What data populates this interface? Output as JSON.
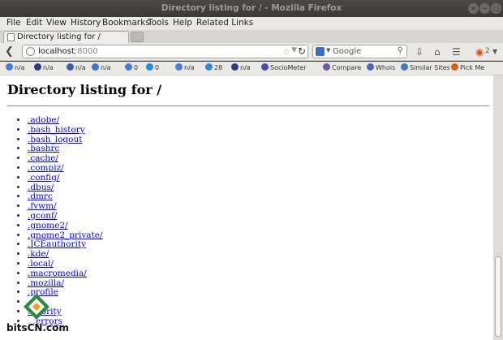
{
  "window": {
    "title": "Directory listing for / - Mozilla Firefox",
    "buttons": [
      "×",
      "−",
      "□"
    ]
  },
  "menu": [
    "File",
    "Edit",
    "View",
    "History",
    "Bookmarks",
    "Tools",
    "Help",
    "Related Links"
  ],
  "tab": {
    "label": "Directory listing for /"
  },
  "urlbar": {
    "host": "localhost",
    "port": ":8000"
  },
  "search": {
    "placeholder": "Google"
  },
  "addon_badge": "2",
  "bookmarks": [
    {
      "label": "n/a",
      "icon": "google-icon",
      "color": "#4a7bd8"
    },
    {
      "label": "n/a",
      "icon": "page-rank-icon",
      "color": "#2d3b8a"
    },
    {
      "label": "n/a",
      "icon": "stats-icon",
      "color": "#3a5ea8"
    },
    {
      "label": "n/a",
      "icon": "alexa-icon",
      "color": "#3b77c9"
    },
    {
      "label": "0",
      "icon": "google-icon",
      "color": "#4a7bd8"
    },
    {
      "label": "0",
      "icon": "bing-icon",
      "color": "#2a8ad4"
    },
    {
      "label": "n/a",
      "icon": "google-icon",
      "color": "#4a7bd8"
    },
    {
      "label": "28",
      "icon": "bing-icon",
      "color": "#2a8ad4"
    },
    {
      "label": "n/a",
      "icon": "page-rank-icon",
      "color": "#2d3b8a"
    },
    {
      "label": "SocioMeter",
      "icon": "chart-icon",
      "color": "#4a4aa8"
    },
    {
      "label": "Compare",
      "icon": "compare-icon",
      "color": "#6a5aa0"
    },
    {
      "label": "Whois",
      "icon": "whois-icon",
      "color": "#4a6ab0"
    },
    {
      "label": "Similar Sites",
      "icon": "similar-sites-icon",
      "color": "#3a7ac0"
    },
    {
      "label": "Pick Me",
      "icon": "pick-me-icon",
      "color": "#d06020"
    }
  ],
  "page": {
    "heading": "Directory listing for /",
    "entries": [
      ".adobe/",
      ".bash_history",
      ".bash_logout",
      ".bashrc",
      ".cache/",
      ".compiz/",
      ".config/",
      ".dbus/",
      ".dmrc",
      ".fvwm/",
      ".gconf/",
      ".gnome2/",
      ".gnome2_private/",
      ".ICEauthority",
      ".kde/",
      ".local/",
      ".macromedia/",
      ".mozilla/",
      ".profile",
      "",
      "...hority",
      "...errors"
    ]
  },
  "watermark": "bitsCN.com"
}
